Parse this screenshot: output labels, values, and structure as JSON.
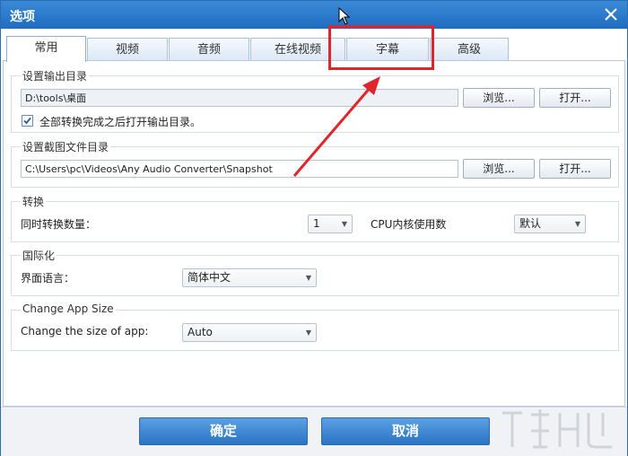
{
  "window": {
    "title": "选项"
  },
  "tabs": [
    {
      "label": "常用",
      "active": true
    },
    {
      "label": "视频",
      "active": false
    },
    {
      "label": "音频",
      "active": false
    },
    {
      "label": "在线视频",
      "active": false
    },
    {
      "label": "字幕",
      "active": false
    },
    {
      "label": "高级",
      "active": false
    }
  ],
  "output_dir": {
    "legend": "设置输出目录",
    "path": "D:\\tools\\桌面",
    "browse_label": "浏览...",
    "open_label": "打开...",
    "checkbox_label": "全部转换完成之后打开输出目录。",
    "checked": true
  },
  "snapshot_dir": {
    "legend": "设置截图文件目录",
    "path": "C:\\Users\\pc\\Videos\\Any Audio Converter\\Snapshot",
    "browse_label": "浏览...",
    "open_label": "打开..."
  },
  "convert": {
    "legend": "转换",
    "count_label": "同时转换数量：",
    "count_value": "1",
    "cpu_label": "CPU内核使用数",
    "cpu_value": "默认"
  },
  "i18n": {
    "legend": "国际化",
    "lang_label": "界面语言：",
    "lang_value": "简体中文"
  },
  "app_size": {
    "legend": "Change App Size",
    "size_label": "Change the size of app:",
    "size_value": "Auto"
  },
  "footer": {
    "ok_label": "确定",
    "cancel_label": "取消"
  },
  "colors": {
    "accent": "#2b74c3",
    "highlight": "#e0262b"
  },
  "icons": {
    "close": "close-icon",
    "cursor": "mouse-cursor-icon",
    "check": "checkmark-icon"
  }
}
